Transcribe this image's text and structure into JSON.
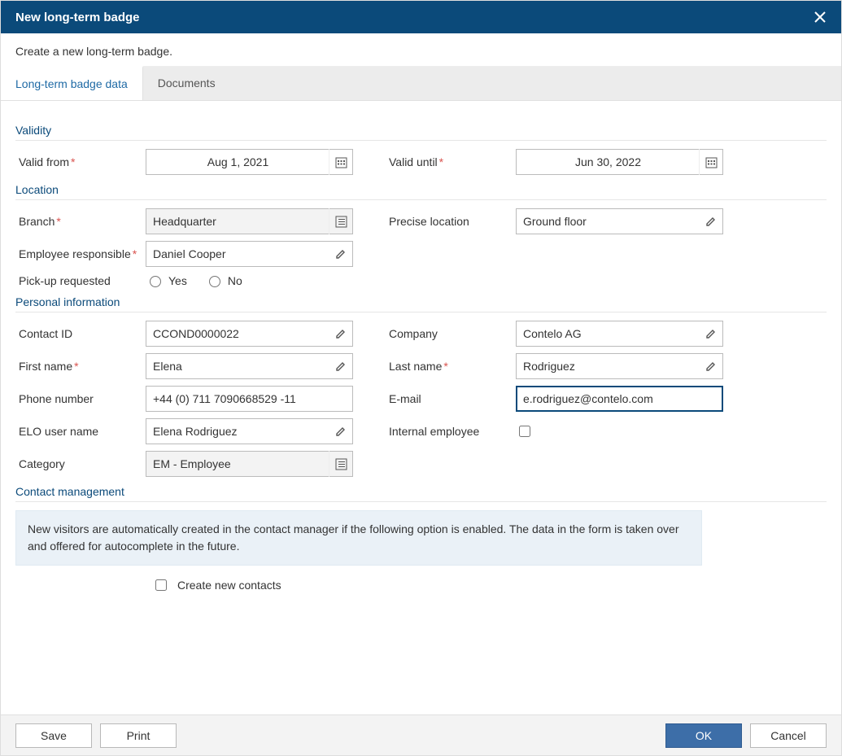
{
  "header": {
    "title": "New long-term badge",
    "subtitle": "Create a new long-term badge."
  },
  "tabs": [
    {
      "label": "Long-term badge data",
      "active": true
    },
    {
      "label": "Documents",
      "active": false
    }
  ],
  "sections": {
    "validity": {
      "title": "Validity",
      "valid_from_label": "Valid from",
      "valid_from_value": "Aug 1, 2021",
      "valid_until_label": "Valid until",
      "valid_until_value": "Jun 30, 2022"
    },
    "location": {
      "title": "Location",
      "branch_label": "Branch",
      "branch_value": "Headquarter",
      "precise_location_label": "Precise location",
      "precise_location_value": "Ground floor",
      "employee_responsible_label": "Employee responsible",
      "employee_responsible_value": "Daniel Cooper",
      "pickup_label": "Pick-up requested",
      "pickup_yes": "Yes",
      "pickup_no": "No"
    },
    "personal": {
      "title": "Personal information",
      "contact_id_label": "Contact ID",
      "contact_id_value": "CCOND0000022",
      "company_label": "Company",
      "company_value": "Contelo AG",
      "firstname_label": "First name",
      "firstname_value": "Elena",
      "lastname_label": "Last name",
      "lastname_value": "Rodriguez",
      "phone_label": "Phone number",
      "phone_value": "+44 (0) 711 7090668529 -11",
      "email_label": "E-mail",
      "email_value": "e.rodriguez@contelo.com",
      "elo_user_label": "ELO user name",
      "elo_user_value": "Elena Rodriguez",
      "internal_label": "Internal employee",
      "category_label": "Category",
      "category_value": "EM - Employee"
    },
    "contact_mgmt": {
      "title": "Contact management",
      "info": "New visitors are automatically created in the contact manager if the following option is enabled. The data in the form is taken over and offered for autocomplete in the future.",
      "create_new_contacts_label": "Create new contacts"
    }
  },
  "footer": {
    "save": "Save",
    "print": "Print",
    "ok": "OK",
    "cancel": "Cancel"
  }
}
